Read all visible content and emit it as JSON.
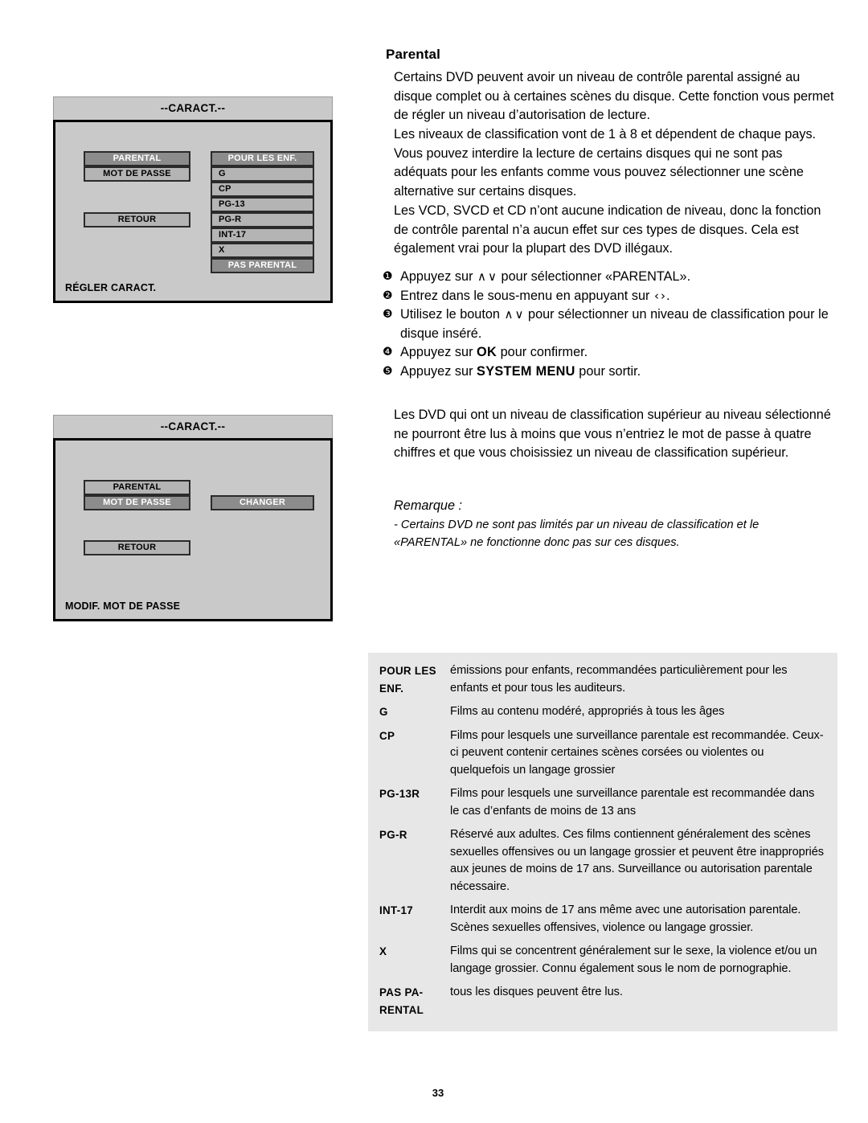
{
  "page": {
    "number": "33"
  },
  "section": {
    "title": "Parental",
    "paragraphs": [
      "Certains DVD peuvent avoir un niveau de contrôle parental assigné au disque complet ou à certaines scènes du disque. Cette fonction vous permet de régler un niveau d’autorisation de lecture.",
      "Les niveaux de classification vont de 1 à 8 et dépendent de chaque pays. Vous pouvez interdire la lecture de certains disques qui ne sont pas adéquats pour les enfants comme vous pouvez sélectionner une scène alternative sur certains disques.",
      "Les VCD, SVCD et CD n’ont aucune indication de niveau, donc la fonction de contrôle parental n’a aucun effet sur ces types de disques. Cela est également vrai pour la plupart des DVD illégaux."
    ],
    "paragraph_after_steps": "Les DVD qui ont un niveau de classification supérieur au niveau sélectionné ne pourront être lus à moins que vous n’entriez le mot de passe à quatre chiffres et que vous choisissiez un niveau de classification supérieur."
  },
  "steps": [
    {
      "marker": "❶",
      "pre": "Appuyez sur ",
      "chevrons": [
        "∧",
        "∨"
      ],
      "mid": " pour sélectionner «PARENTAL».",
      "bold": "",
      "post": ""
    },
    {
      "marker": "❷",
      "pre": "Entrez dans le sous-menu en appuyant sur ",
      "chevrons": [
        "‹",
        "›"
      ],
      "mid": ".",
      "bold": "",
      "post": ""
    },
    {
      "marker": "❸",
      "pre": "Utilisez le bouton ",
      "chevrons": [
        "∧",
        "∨"
      ],
      "mid": " pour sélectionner un niveau de classification pour le disque inséré.",
      "bold": "",
      "post": ""
    },
    {
      "marker": "❹",
      "pre": "Appuyez sur ",
      "chevrons": [],
      "mid": "",
      "bold": "OK",
      "post": " pour confirmer."
    },
    {
      "marker": "❺",
      "pre": "Appuyez sur ",
      "chevrons": [],
      "mid": "",
      "bold": "SYSTEM MENU",
      "post": " pour sortir."
    }
  ],
  "note": {
    "heading": "Remarque :",
    "line1": "- Certains DVD ne sont pas limités par un niveau de classification et le",
    "line2": "«PARENTAL» ne fonctionne donc pas sur ces disques."
  },
  "osd_screen_1": {
    "title": "--CARACT.--",
    "footer": "RÉGLER CARACT.",
    "left_items": [
      {
        "label": "PARENTAL",
        "selected": true
      },
      {
        "label": "MOT DE PASSE",
        "selected": false
      }
    ],
    "back_label": "RETOUR",
    "rating_items": [
      {
        "label": "POUR LES ENF.",
        "highlighted": true,
        "align": "center"
      },
      {
        "label": "G",
        "highlighted": false,
        "align": "left"
      },
      {
        "label": "CP",
        "highlighted": false,
        "align": "left"
      },
      {
        "label": "PG-13",
        "highlighted": false,
        "align": "left"
      },
      {
        "label": "PG-R",
        "highlighted": false,
        "align": "left"
      },
      {
        "label": "INT-17",
        "highlighted": false,
        "align": "left"
      },
      {
        "label": "X",
        "highlighted": false,
        "align": "left"
      },
      {
        "label": "PAS PARENTAL",
        "highlighted": true,
        "align": "center"
      }
    ]
  },
  "osd_screen_2": {
    "title": "--CARACT.--",
    "footer": "MODIF. MOT DE PASSE",
    "left_items": [
      {
        "label": "PARENTAL",
        "selected": false
      },
      {
        "label": "MOT DE PASSE",
        "selected": true
      }
    ],
    "back_label": "RETOUR",
    "action_label": "CHANGER"
  },
  "ratings_table": {
    "rows": [
      {
        "key": "POUR LES ENF.",
        "value": "émissions pour enfants, recommandées particulièrement pour les enfants et pour tous les auditeurs."
      },
      {
        "key": "G",
        "value": "Films au contenu modéré, appropriés à tous les âges"
      },
      {
        "key": "CP",
        "value": "Films pour lesquels une surveillance parentale est recommandée. Ceux-ci peuvent contenir certaines scènes corsées ou violentes ou quelquefois un langage grossier"
      },
      {
        "key": "PG-13R",
        "value": "Films pour lesquels une surveillance parentale est recommandée dans le cas d’enfants de moins de 13 ans"
      },
      {
        "key": "PG-R",
        "value": "Réservé aux adultes. Ces films contiennent généralement des scènes sexuelles offensives ou un langage grossier et peuvent être inappropriés aux jeunes de moins de 17 ans. Surveillance ou autorisation parentale nécessaire."
      },
      {
        "key": "INT-17",
        "value": "Interdit aux moins de 17 ans même avec une autorisation parentale. Scènes sexuelles offensives, violence ou langage grossier."
      },
      {
        "key": "X",
        "value": "Films qui se concentrent généralement sur le sexe, la violence et/ou un langage grossier. Connu également sous le nom de pornographie."
      },
      {
        "key": "PAS PA-RENTAL",
        "value": "tous les disques peuvent être lus."
      }
    ]
  },
  "colors": {
    "osd_background": "#c9c9c9",
    "osd_button": "#b4b4b4",
    "osd_button_selected": "#8c8c8c",
    "table_background": "#e7e7e7"
  }
}
